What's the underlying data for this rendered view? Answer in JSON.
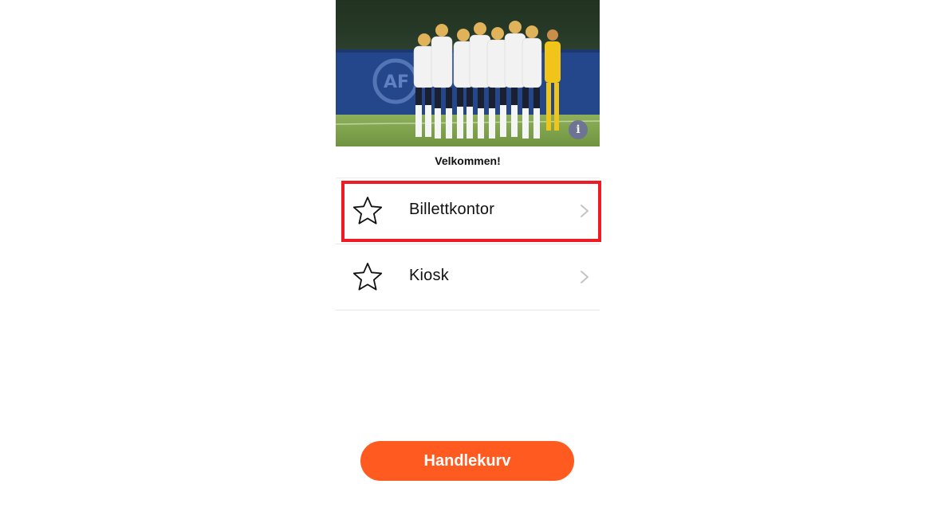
{
  "hero": {
    "info_icon_glyph": "i",
    "photo_description_icon": "team-photo"
  },
  "welcome": {
    "text": "Velkommen!"
  },
  "menu": {
    "items": [
      {
        "label": "Billettkontor",
        "icon": "star-icon",
        "highlighted": true
      },
      {
        "label": "Kiosk",
        "icon": "star-icon",
        "highlighted": false
      }
    ]
  },
  "cart": {
    "label": "Handlekurv"
  },
  "colors": {
    "accent": "#ff5a1f",
    "highlight": "#ee1b24",
    "divider": "#e6e6e6"
  }
}
